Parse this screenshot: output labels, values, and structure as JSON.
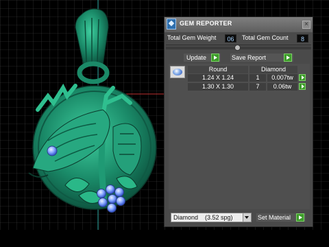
{
  "panel": {
    "title": "GEM REPORTER",
    "close_glyph": "×",
    "total_weight_label": "Total Gem Weight",
    "total_weight_value": "06",
    "total_count_label": "Total Gem Count",
    "total_count_value": "8",
    "update_label": "Update",
    "save_report_label": "Save Report"
  },
  "gem_table": {
    "shape_header": "Round",
    "material_header": "Diamond",
    "rows": [
      {
        "size": "1.24 X 1.24",
        "count": "1",
        "weight": "0.007tw"
      },
      {
        "size": "1.30 X 1.30",
        "count": "7",
        "weight": "0.06tw"
      }
    ]
  },
  "material": {
    "selected": "Diamond    (3.52 spg)",
    "set_material_label": "Set Material"
  },
  "colors": {
    "model_green": "#1e8a6c",
    "gem_blue": "#7fa4ff",
    "button_green": "#3d9c2a",
    "grid_line": "#4a4a4a"
  }
}
